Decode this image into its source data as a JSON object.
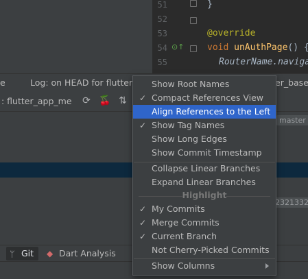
{
  "editor": {
    "lines": [
      {
        "num": "51",
        "code": "}"
      },
      {
        "num": "52",
        "code": ""
      },
      {
        "num": "53",
        "code": "@override"
      },
      {
        "num": "54",
        "code_kw": "void ",
        "code_fn": "unAuthPage",
        "code_rest": "() {"
      },
      {
        "num": "55",
        "code": "RouterName.naviga"
      }
    ]
  },
  "tabs": {
    "partial_left": "e",
    "log_tab": "Log: on HEAD for flutter_b",
    "right_partial": "er_base_"
  },
  "toolbar": {
    "branch_filter": ": flutter_app_me",
    "branch_suffix": "▾"
  },
  "tags": {
    "master": "master",
    "hash": "2321332"
  },
  "bottom": {
    "git_label": "Git",
    "dart_label": "Dart Analysis"
  },
  "menu": {
    "items": [
      {
        "label": "Show Root Names",
        "checked": false
      },
      {
        "label": "Compact References View",
        "checked": true
      },
      {
        "label": "Align References to the Left",
        "checked": false,
        "active": true
      },
      {
        "label": "Show Tag Names",
        "checked": true
      },
      {
        "label": "Show Long Edges",
        "checked": false
      },
      {
        "label": "Show Commit Timestamp",
        "checked": false
      },
      {
        "label": "Collapse Linear Branches",
        "checked": false
      },
      {
        "label": "Expand Linear Branches",
        "checked": false
      },
      {
        "label": "My Commits",
        "checked": true
      },
      {
        "label": "Merge Commits",
        "checked": true
      },
      {
        "label": "Current Branch",
        "checked": true
      },
      {
        "label": "Not Cherry-Picked Commits",
        "checked": false
      },
      {
        "label": "Show Columns",
        "checked": false,
        "submenu": true
      }
    ],
    "highlight_header": "Highlight",
    "check_glyph": "✓"
  },
  "colors": {
    "accent": "#2f65ca",
    "selection": "#0d293e",
    "keyword": "#cc7832",
    "annotation": "#bbb529",
    "function": "#ffc66d"
  }
}
